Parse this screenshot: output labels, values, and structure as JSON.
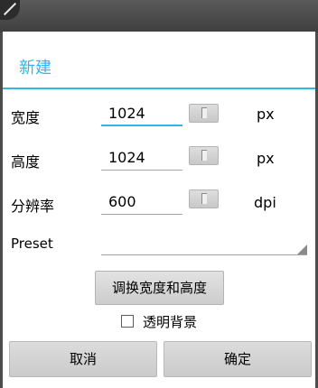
{
  "dialog": {
    "title": "新建",
    "rows": [
      {
        "label": "宽度",
        "value": "1024",
        "unit": "px"
      },
      {
        "label": "高度",
        "value": "1024",
        "unit": "px"
      },
      {
        "label": "分辨率",
        "value": "600",
        "unit": "dpi"
      }
    ],
    "preset_label": "Preset",
    "preset_value": "",
    "swap_label": "调换宽度和高度",
    "transparent_label": "透明背景",
    "transparent_checked": false,
    "cancel_label": "取消",
    "ok_label": "确定"
  },
  "colors": {
    "accent": "#33b5e5",
    "overlay": "#4c4c4c"
  }
}
